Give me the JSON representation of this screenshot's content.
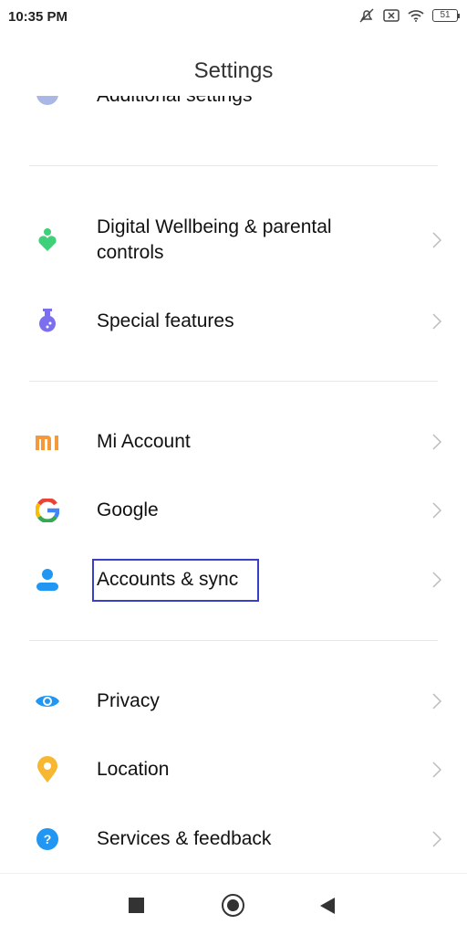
{
  "status_bar": {
    "time": "10:35 PM",
    "battery": "51"
  },
  "header": {
    "title": "Settings"
  },
  "items": [
    {
      "label": "Additional settings",
      "icon": "more-icon"
    },
    {
      "label": "Digital Wellbeing & parental controls",
      "icon": "wellbeing-icon"
    },
    {
      "label": "Special features",
      "icon": "flask-icon"
    },
    {
      "label": "Mi Account",
      "icon": "mi-logo-icon"
    },
    {
      "label": "Google",
      "icon": "google-icon"
    },
    {
      "label": "Accounts & sync",
      "icon": "person-icon"
    },
    {
      "label": "Privacy",
      "icon": "eye-icon"
    },
    {
      "label": "Location",
      "icon": "location-pin-icon"
    },
    {
      "label": "Services & feedback",
      "icon": "help-icon"
    }
  ],
  "colors": {
    "highlight": "#3a3fc7",
    "mi": "#f39a3c",
    "wellbeing": "#3fd07a",
    "flask": "#7b6ff0",
    "blue": "#2196f3"
  }
}
